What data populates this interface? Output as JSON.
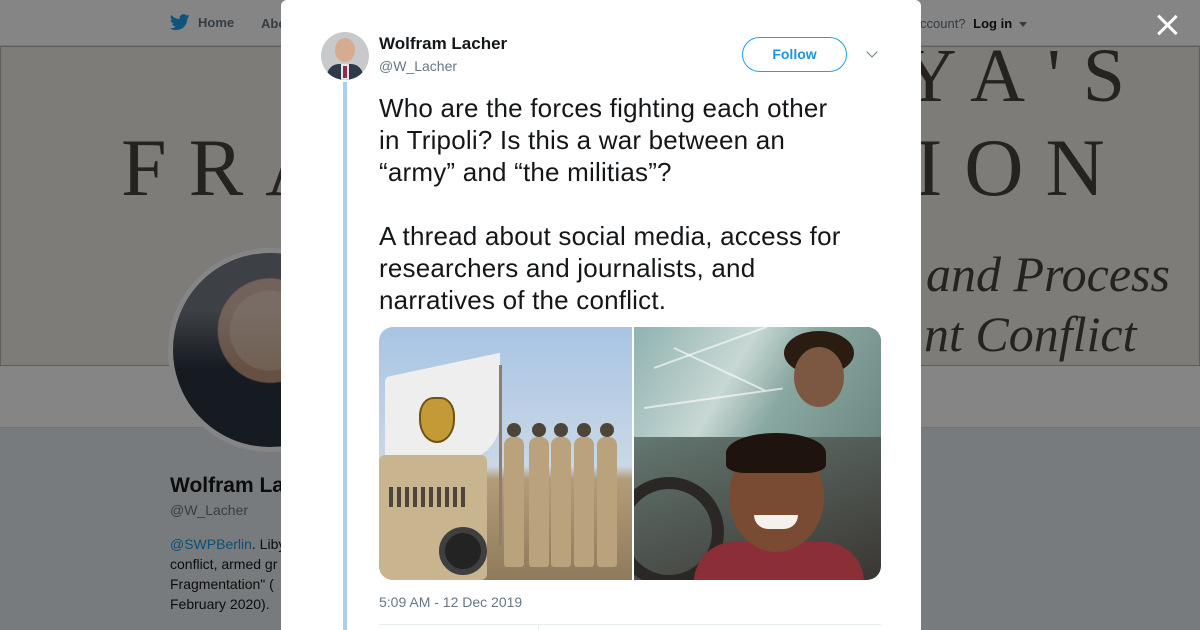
{
  "nav": {
    "home_label": "Home",
    "about_label": "Abo",
    "account_text": "ccount?",
    "login_label": "Log in"
  },
  "banner": {
    "top_text": "YA'S",
    "left_text": "FRA",
    "right_text": "ION",
    "sub_line_1": "and Process",
    "sub_line_2": "nt Conflict"
  },
  "profile": {
    "name": "Wolfram La",
    "handle": "@W_Lacher",
    "bio_link": "@SWPBerlin",
    "bio_lines": [
      ". Liby",
      "conflict, armed gr",
      "Fragmentation\" (",
      "February 2020)."
    ]
  },
  "tweet": {
    "author_name": "Wolfram Lacher",
    "author_handle": "@W_Lacher",
    "follow_label": "Follow",
    "text_lines": [
      "Who are the forces fighting each other",
      "in Tripoli? Is this a war between an",
      "“army” and “the militias”?",
      "",
      "A thread about social media, access for",
      "researchers and journalists, and",
      "narratives of the conflict."
    ],
    "timestamp": "5:09 AM - 12 Dec 2019"
  },
  "colors": {
    "brand_blue": "#1da1f2",
    "link_blue": "#1b95e0",
    "thread_line": "#a8cfec",
    "text_primary": "#14171a",
    "text_secondary": "#657786"
  },
  "icons": {
    "nav_home": "twitter-bird-icon",
    "close": "close-icon",
    "tweet_menu": "chevron-down-icon"
  }
}
